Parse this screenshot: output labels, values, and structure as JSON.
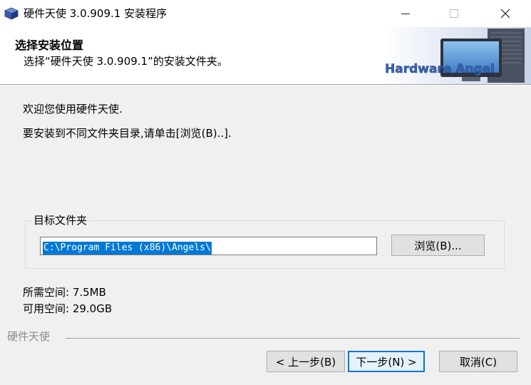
{
  "window": {
    "title": "硬件天使 3.0.909.1 安装程序",
    "app_icon": "cube-package-icon",
    "controls": {
      "minimize": "minimize-icon",
      "maximize": "maximize-icon",
      "close": "close-icon"
    }
  },
  "header": {
    "title": "选择安装位置",
    "subtitle": "选择“硬件天使 3.0.909.1”的安装文件夹。",
    "banner_text": "Hardware Angel"
  },
  "body": {
    "intro_line1": "欢迎您使用硬件天使.",
    "intro_line2": "要安装到不同文件夹目录,请单击[浏览(B)..].",
    "destination": {
      "legend": "目标文件夹",
      "path": "C:\\Program Files (x86)\\Angels\\",
      "browse_label": "浏览(B)..."
    },
    "space_required": "所需空间: 7.5MB",
    "space_available": "可用空间: 29.0GB"
  },
  "footer": {
    "brand": "硬件天使",
    "back_label": "< 上一步(B)",
    "next_label": "下一步(N) >",
    "cancel_label": "取消(C)"
  },
  "colors": {
    "selection": "#0078d7",
    "dialog_bg": "#f0f0f0",
    "button_bg": "#e1e1e1"
  }
}
